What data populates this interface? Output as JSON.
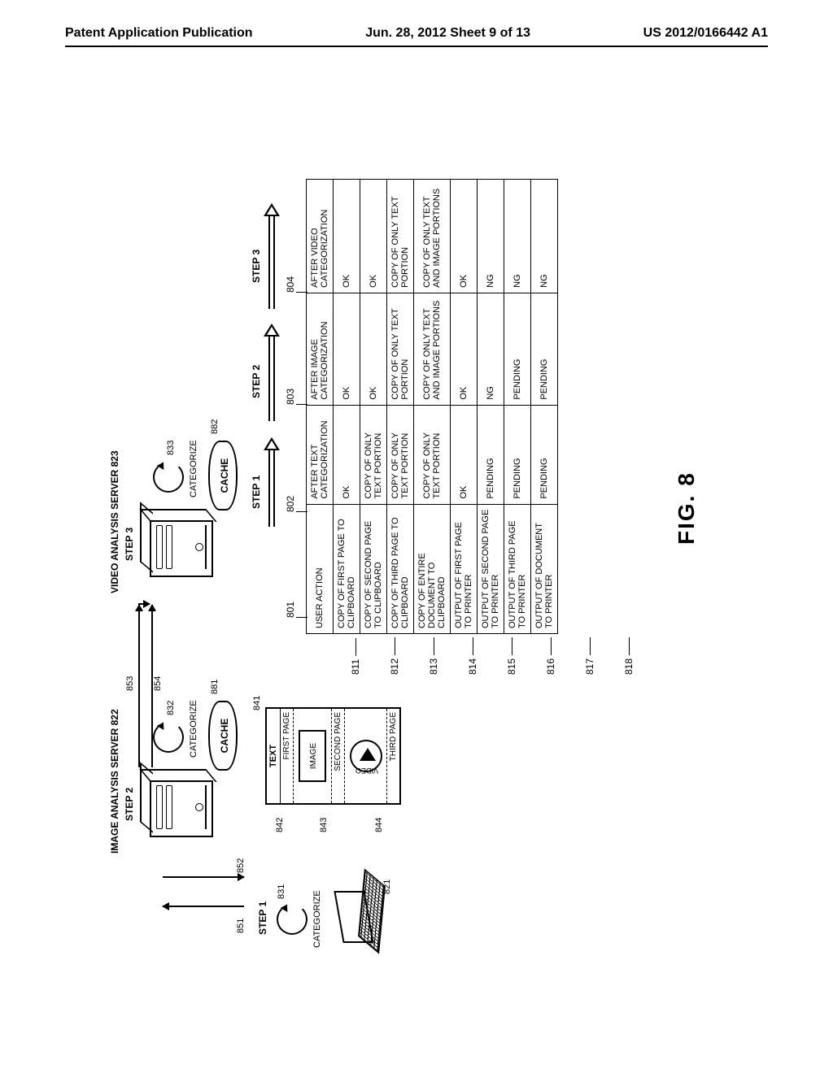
{
  "header": {
    "left": "Patent Application Publication",
    "mid": "Jun. 28, 2012  Sheet 9 of 13",
    "right": "US 2012/0166442 A1"
  },
  "figure_label": "FIG. 8",
  "diagram": {
    "image_server_title": "IMAGE ANALYSIS SERVER 822",
    "video_server_title": "VIDEO ANALYSIS SERVER 823",
    "step_top2": "STEP 2",
    "step_top3": "STEP 3",
    "step1": "STEP 1",
    "step2": "STEP 2",
    "step3": "STEP 3",
    "categorize": "CATEGORIZE",
    "cache": "CACHE",
    "ref_831": "831",
    "ref_832": "832",
    "ref_833": "833",
    "ref_881": "881",
    "ref_882": "882",
    "ref_851": "851",
    "ref_852": "852",
    "ref_853": "853",
    "ref_854": "854",
    "ref_821": "821",
    "ref_841": "841",
    "ref_842": "842",
    "ref_843": "843",
    "ref_844": "844",
    "doc_text": "TEXT",
    "doc_first": "FIRST PAGE",
    "doc_second": "SECOND PAGE",
    "doc_third": "THIRD PAGE",
    "doc_image": "IMAGE",
    "doc_video": "VIDEO"
  },
  "table": {
    "col_user_action": "USER ACTION",
    "col_after_text": "AFTER TEXT CATEGORIZATION",
    "col_after_image": "AFTER IMAGE CATEGORIZATION",
    "col_after_video": "AFTER VIDEO CATEGORIZATION",
    "col_ref_801": "801",
    "col_ref_802": "802",
    "col_ref_803": "803",
    "col_ref_804": "804",
    "rows": [
      {
        "ref": "811",
        "action": "COPY OF FIRST PAGE TO CLIPBOARD",
        "t": "OK",
        "i": "OK",
        "v": "OK"
      },
      {
        "ref": "812",
        "action": "COPY OF SECOND PAGE TO CLIPBOARD",
        "t": "COPY OF ONLY TEXT PORTION",
        "i": "OK",
        "v": "OK"
      },
      {
        "ref": "813",
        "action": "COPY OF THIRD PAGE TO CLIPBOARD",
        "t": "COPY OF ONLY TEXT PORTION",
        "i": "COPY OF ONLY TEXT PORTION",
        "v": "COPY OF ONLY TEXT PORTION"
      },
      {
        "ref": "814",
        "action": "COPY OF ENTIRE DOCUMENT TO CLIPBOARD",
        "t": "COPY OF ONLY TEXT PORTION",
        "i": "COPY OF ONLY TEXT AND IMAGE PORTIONS",
        "v": "COPY OF ONLY TEXT AND IMAGE PORTIONS"
      },
      {
        "ref": "815",
        "action": "OUTPUT OF FIRST PAGE TO PRINTER",
        "t": "OK",
        "i": "OK",
        "v": "OK"
      },
      {
        "ref": "816",
        "action": "OUTPUT OF SECOND PAGE TO PRINTER",
        "t": "PENDING",
        "i": "NG",
        "v": "NG"
      },
      {
        "ref": "817",
        "action": "OUTPUT OF THIRD PAGE TO PRINTER",
        "t": "PENDING",
        "i": "PENDING",
        "v": "NG"
      },
      {
        "ref": "818",
        "action": "OUTPUT OF DOCUMENT TO PRINTER",
        "t": "PENDING",
        "i": "PENDING",
        "v": "NG"
      }
    ]
  }
}
